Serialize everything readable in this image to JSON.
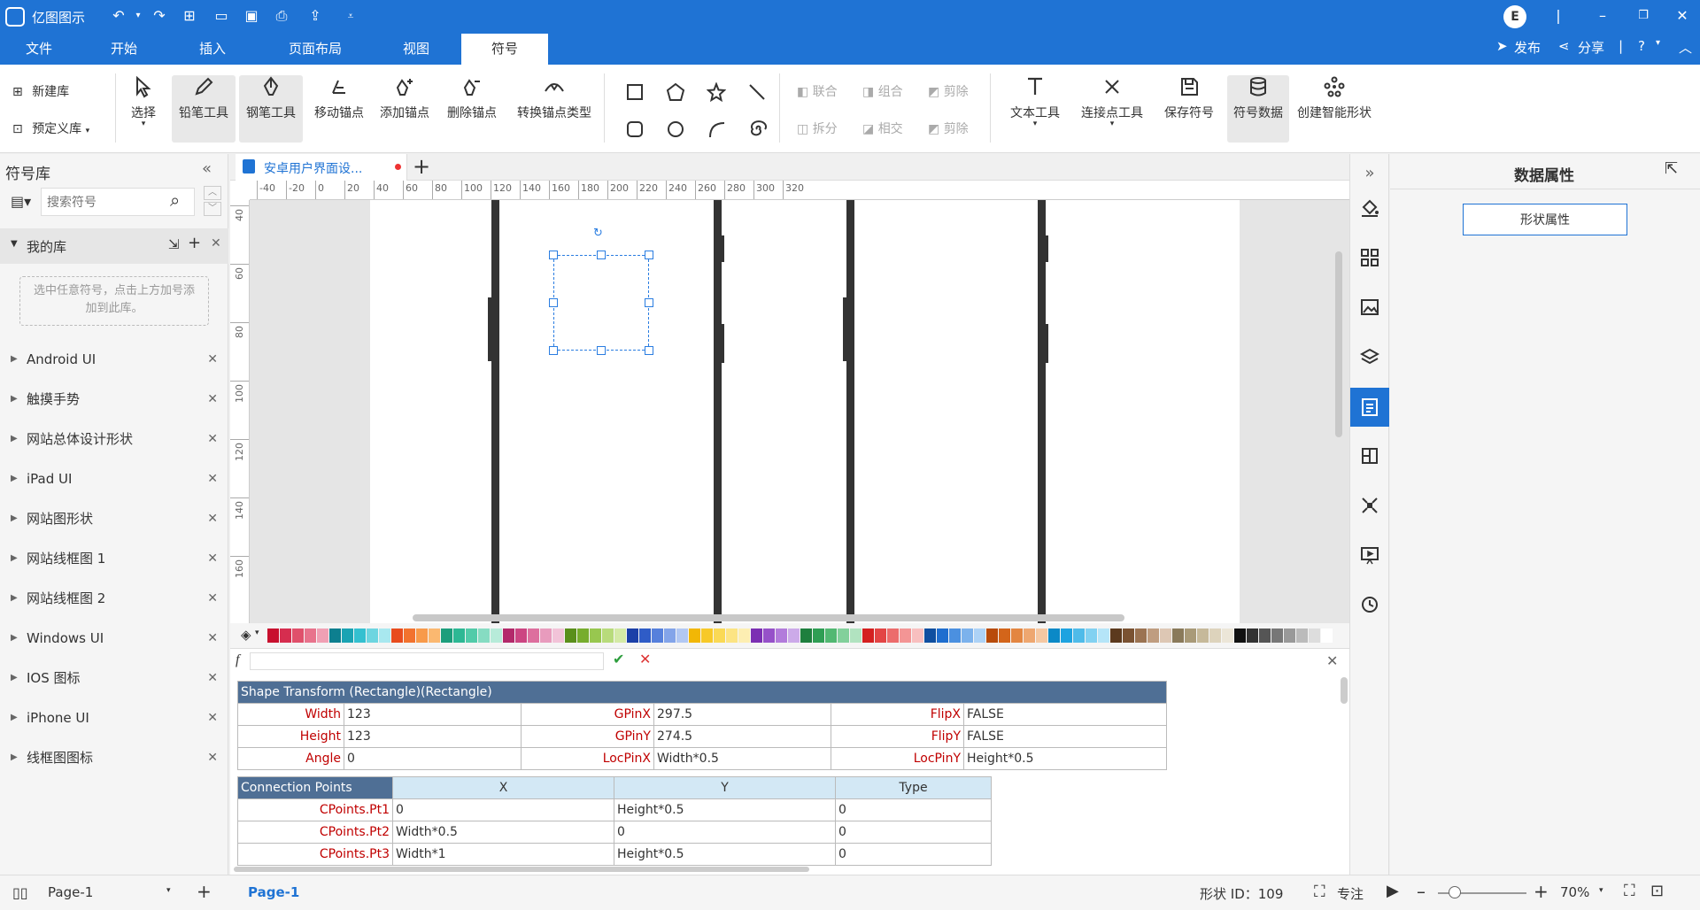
{
  "app": {
    "name": "亿图图示"
  },
  "menu": {
    "tabs": [
      "文件",
      "开始",
      "插入",
      "页面布局",
      "视图",
      "符号"
    ],
    "active": "符号",
    "publish": "发布",
    "share": "分享",
    "user_initial": "E"
  },
  "ribbon": {
    "new_lib": "新建库",
    "predefined_lib": "预定义库",
    "tools": [
      "选择",
      "铅笔工具",
      "钢笔工具",
      "移动锚点",
      "添加锚点",
      "删除锚点",
      "转换锚点类型"
    ],
    "boolean_ops": [
      "联合",
      "组合",
      "剪除",
      "拆分",
      "相交",
      "剪除"
    ],
    "text_tool": "文本工具",
    "connect_tool": "连接点工具",
    "save_symbol": "保存符号",
    "symbol_data": "符号数据",
    "smart_shape": "创建智能形状"
  },
  "left_panel": {
    "title": "符号库",
    "search_placeholder": "搜索符号",
    "my_lib": "我的库",
    "my_lib_hint": "选中任意符号，点击上方加号添加到此库。",
    "libraries": [
      "Android UI",
      "触摸手势",
      "网站总体设计形状",
      "iPad UI",
      "网站图形状",
      "网站线框图 1",
      "网站线框图 2",
      "Windows UI",
      "IOS 图标",
      "iPhone UI",
      "线框图图标"
    ]
  },
  "doc_tab": {
    "title": "安卓用户界面设...",
    "modified": true
  },
  "rulers": {
    "h": [
      "-40",
      "-20",
      "0",
      "20",
      "40",
      "60",
      "80",
      "100",
      "120",
      "140",
      "160",
      "180",
      "200",
      "220",
      "240",
      "260",
      "280",
      "300",
      "320"
    ],
    "v": [
      "40",
      "60",
      "80",
      "100",
      "120",
      "140",
      "160"
    ]
  },
  "palette": [
    "#c8102e",
    "#d62d4f",
    "#e0506b",
    "#e8738c",
    "#f0a0b4",
    "#0d7f8f",
    "#1aa3b3",
    "#34c0d0",
    "#6dd5e0",
    "#a8e8ef",
    "#e84c1e",
    "#f2722e",
    "#f89a4a",
    "#fbb870",
    "#1c9e7c",
    "#2db894",
    "#52cba9",
    "#86dcc2",
    "#b7ebd9",
    "#b3296a",
    "#cc4582",
    "#dd6f9e",
    "#e89bbd",
    "#f2c3d8",
    "#5a8f1b",
    "#77ad2e",
    "#98c74f",
    "#b8db7b",
    "#d4eaa6",
    "#1b3fa8",
    "#2f5cc7",
    "#5680dc",
    "#83a4e9",
    "#b2c8f3",
    "#f2b705",
    "#f7c928",
    "#fad955",
    "#fce483",
    "#fdeeb2",
    "#7b2fb3",
    "#9651c9",
    "#b27bdb",
    "#ccaae9",
    "#1e7f3e",
    "#2f9e54",
    "#52b872",
    "#82d09b",
    "#b1e3c0",
    "#d42020",
    "#e34545",
    "#ec6c6c",
    "#f39595",
    "#f8bfbf",
    "#0f4fa0",
    "#1f6ecf",
    "#4b90e0",
    "#7cb2ec",
    "#add2f6",
    "#b84b0a",
    "#d3651a",
    "#e38641",
    "#eea770",
    "#f5c8a2",
    "#0b89c7",
    "#1ea3e0",
    "#4fbbe9",
    "#82d1f1",
    "#b5e5f8",
    "#5c3a1e",
    "#7a5232",
    "#9b7352",
    "#bf9d80",
    "#ddc7b4",
    "#8a7a5a",
    "#a99a78",
    "#c6b99a",
    "#ddd3bc",
    "#ece6d8",
    "#111111",
    "#333333",
    "#555555",
    "#777777",
    "#999999",
    "#bbbbbb",
    "#dddddd",
    "#ffffff"
  ],
  "shape_sheet": {
    "title": "Shape Transform (Rectangle)(Rectangle)",
    "rows": [
      [
        [
          "Width",
          "123"
        ],
        [
          "GPinX",
          "297.5"
        ],
        [
          "FlipX",
          "FALSE"
        ]
      ],
      [
        [
          "Height",
          "123"
        ],
        [
          "GPinY",
          "274.5"
        ],
        [
          "FlipY",
          "FALSE"
        ]
      ],
      [
        [
          "Angle",
          "0"
        ],
        [
          "LocPinX",
          "Width*0.5"
        ],
        [
          "LocPinY",
          "Height*0.5"
        ]
      ]
    ],
    "cp_headers": [
      "Connection Points",
      "X",
      "Y",
      "Type"
    ],
    "cp_rows": [
      [
        "CPoints.Pt1",
        "0",
        "Height*0.5",
        "0"
      ],
      [
        "CPoints.Pt2",
        "Width*0.5",
        "0",
        "0"
      ],
      [
        "CPoints.Pt3",
        "Width*1",
        "Height*0.5",
        "0"
      ]
    ]
  },
  "right_panel": {
    "title": "数据属性",
    "shape_props_button": "形状属性"
  },
  "status": {
    "page_selector": "Page-1",
    "page_tab": "Page-1",
    "shape_id": "形状 ID：109",
    "focus": "专注",
    "zoom": "70%"
  }
}
